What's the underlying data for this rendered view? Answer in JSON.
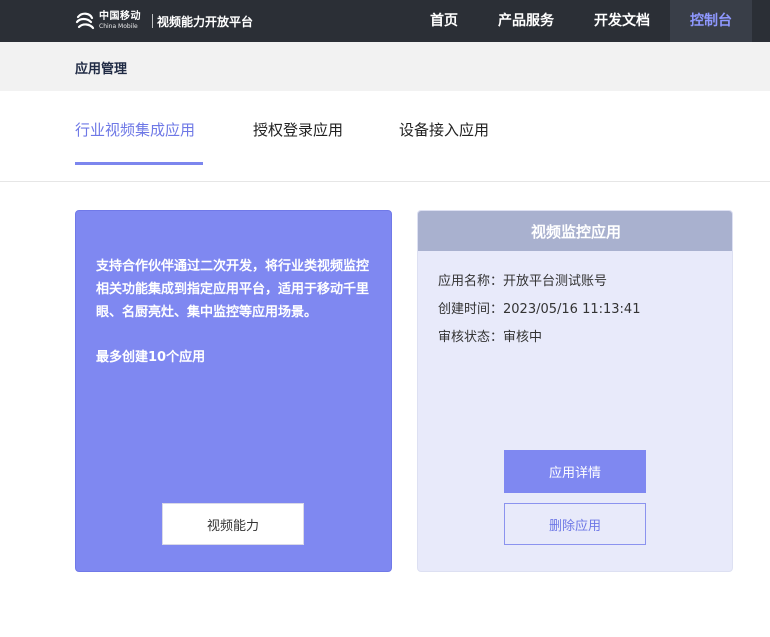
{
  "header": {
    "logo_cn": "中国移动",
    "logo_en": "China Mobile",
    "platform_title": "视频能力开放平台",
    "nav": [
      {
        "label": "首页"
      },
      {
        "label": "产品服务"
      },
      {
        "label": "开发文档"
      },
      {
        "label": "控制台",
        "active": true
      }
    ]
  },
  "breadcrumb": {
    "label": "应用管理"
  },
  "tabs": [
    {
      "label": "行业视频集成应用",
      "active": true
    },
    {
      "label": "授权登录应用"
    },
    {
      "label": "设备接入应用"
    }
  ],
  "intro_card": {
    "description": "支持合作伙伴通过二次开发，将行业类视频监控相关功能集成到指定应用平台，适用于移动千里眼、名厨亮灶、集中监控等应用场景。",
    "limit": "最多创建10个应用",
    "button_label": "视频能力"
  },
  "app_card": {
    "title": "视频监控应用",
    "fields": [
      {
        "label": "应用名称：",
        "value": "开放平台测试账号"
      },
      {
        "label": "创建时间：",
        "value": "2023/05/16 11:13:41"
      },
      {
        "label": "审核状态：",
        "value": "审核中"
      }
    ],
    "detail_button": "应用详情",
    "delete_button": "删除应用"
  },
  "colors": {
    "topbar": "#2b2f36",
    "accent": "#7f88f1",
    "card_header": "#a9b1cf"
  },
  "icons": {
    "logo": "china-mobile-logo-icon"
  }
}
